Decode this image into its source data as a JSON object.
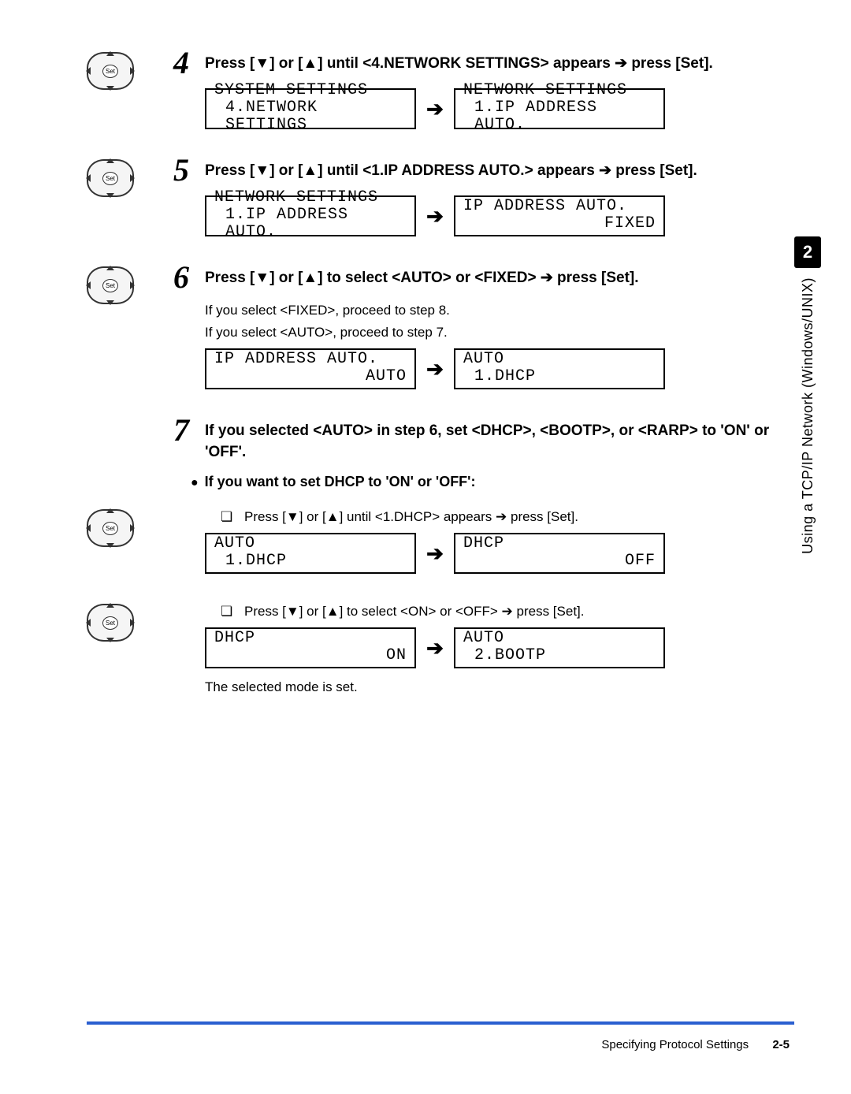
{
  "chapter": {
    "number": "2",
    "title": "Using a TCP/IP Network (Windows/UNIX)"
  },
  "dpad": {
    "set_label": "Set"
  },
  "steps": {
    "s4": {
      "num": "4",
      "text_a": "Press [",
      "text_b": "] or [",
      "text_c": "] until <4.NETWORK SETTINGS> appears ",
      "text_d": " press [Set].",
      "lcd1_l1": "SYSTEM SETTINGS",
      "lcd1_l2": "4.NETWORK SETTINGS",
      "lcd2_l1": "NETWORK SETTINGS",
      "lcd2_l2": "1.IP ADDRESS AUTO."
    },
    "s5": {
      "num": "5",
      "text_a": "Press [",
      "text_b": "] or [",
      "text_c": "] until <1.IP ADDRESS AUTO.> appears ",
      "text_d": " press [Set].",
      "lcd1_l1": "NETWORK SETTINGS",
      "lcd1_l2": "1.IP ADDRESS AUTO.",
      "lcd2_l1": "IP ADDRESS AUTO.",
      "lcd2_r": "FIXED"
    },
    "s6": {
      "num": "6",
      "text_a": "Press [",
      "text_b": "] or [",
      "text_c": "] to select <AUTO> or <FIXED> ",
      "text_d": " press [Set].",
      "note1": "If you select <FIXED>, proceed to step 8.",
      "note2": "If you select <AUTO>, proceed to step 7.",
      "lcd1_l1": "IP ADDRESS AUTO.",
      "lcd1_r": "AUTO",
      "lcd2_l1": "AUTO",
      "lcd2_l2": "1.DHCP"
    },
    "s7": {
      "num": "7",
      "text": "If you selected <AUTO> in step 6, set <DHCP>, <BOOTP>, or <RARP> to 'ON' or 'OFF'.",
      "bullet": "If you want to set DHCP to 'ON' or 'OFF':",
      "sub1_a": "Press [",
      "sub1_b": "] or  [",
      "sub1_c": "] until <1.DHCP> appears ",
      "sub1_d": " press [Set].",
      "lcd1_l1": "AUTO",
      "lcd1_l2": "1.DHCP",
      "lcd2_l1": "DHCP",
      "lcd2_r": "OFF",
      "sub2_a": "Press [",
      "sub2_b": "] or  [",
      "sub2_c": "] to select <ON> or <OFF> ",
      "sub2_d": " press [Set].",
      "lcd3_l1": "DHCP",
      "lcd3_r": "ON",
      "lcd4_l1": "AUTO",
      "lcd4_l2": "2.BOOTP",
      "note": "The selected mode is set."
    }
  },
  "footer": {
    "section": "Specifying Protocol Settings",
    "page": "2-5"
  }
}
